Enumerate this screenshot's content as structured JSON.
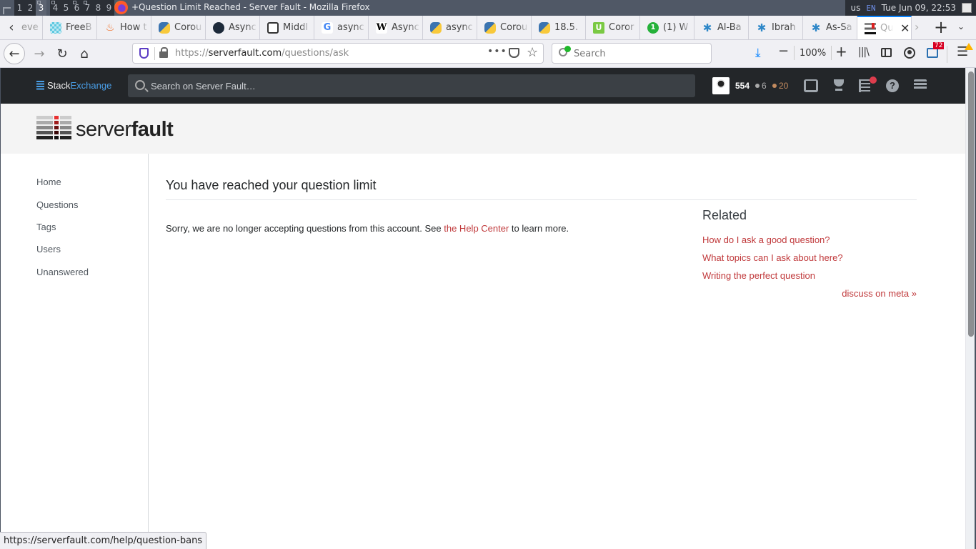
{
  "os_bar": {
    "workspaces": [
      "1",
      "2",
      "3",
      "4",
      "5",
      "6",
      "7",
      "8",
      "9"
    ],
    "active_workspace": "3",
    "window_title": "+Question Limit Reached - Server Fault - Mozilla Firefox",
    "keyboard_layout": "us",
    "lang": "EN",
    "clock": "Tue Jun 09, 22:53"
  },
  "browser": {
    "tabs": [
      {
        "label": "eve",
        "icon": "partial-tab"
      },
      {
        "label": "FreeB",
        "icon": "freeb-favicon"
      },
      {
        "label": "How t",
        "icon": "fire-favicon"
      },
      {
        "label": "Corou",
        "icon": "python-favicon"
      },
      {
        "label": "Async",
        "icon": "github-favicon"
      },
      {
        "label": "Middl",
        "icon": "medium-favicon"
      },
      {
        "label": "async",
        "icon": "google-favicon"
      },
      {
        "label": "Async",
        "icon": "wikipedia-favicon"
      },
      {
        "label": "async",
        "icon": "python-favicon"
      },
      {
        "label": "Corou",
        "icon": "python-favicon"
      },
      {
        "label": "18.5.",
        "icon": "python-favicon"
      },
      {
        "label": "Coror",
        "icon": "worldometer-favicon"
      },
      {
        "label": "(1) W",
        "icon": "whatsapp-favicon"
      },
      {
        "label": "Al-Ba",
        "icon": "star-favicon"
      },
      {
        "label": "Ibrah",
        "icon": "star-favicon"
      },
      {
        "label": "As-Sa",
        "icon": "star-favicon"
      },
      {
        "label": "Qu",
        "icon": "serverfault-favicon",
        "active": true
      }
    ],
    "url_prefix": "https://",
    "url_domain": "serverfault.com",
    "url_path": "/questions/ask",
    "search_placeholder": "Search",
    "zoom_level": "100%",
    "extension_badge": "72",
    "status_url": "https://serverfault.com/help/question-bans"
  },
  "site": {
    "network_name_a": "Stack",
    "network_name_b": "Exchange",
    "search_placeholder": "Search on Server Fault…",
    "user": {
      "reputation": "554",
      "silver_badges": "6",
      "bronze_badges": "20"
    },
    "logo_light": "server",
    "logo_bold": "fault",
    "nav": [
      "Home",
      "Questions",
      "Tags",
      "Users",
      "Unanswered"
    ],
    "page_title": "You have reached your question limit",
    "message_before": "Sorry, we are no longer accepting questions from this account. See ",
    "message_link": "the Help Center",
    "message_after": " to learn more.",
    "related": {
      "heading": "Related",
      "links": [
        "How do I ask a good question?",
        "What topics can I ask about here?",
        "Writing the perfect question"
      ],
      "meta_link": "discuss on meta »"
    },
    "colors": {
      "link_red": "#c0393b",
      "topbar": "#232629",
      "se_blue": "#4a9fe8",
      "bronze": "#c38b5f"
    }
  }
}
